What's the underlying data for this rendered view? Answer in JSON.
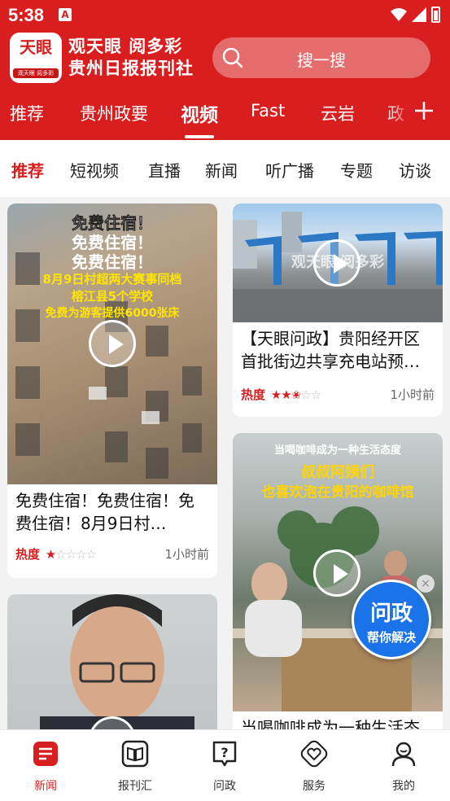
{
  "status_bar": {
    "time": "5:38",
    "notification_badge": "A"
  },
  "header": {
    "logo_text": "天眼",
    "logo_sub": "观天眼 阅多彩",
    "brand_line1": "观天眼 阅多彩",
    "brand_line2": "贵州日报报刊社",
    "search_placeholder": "搜一搜",
    "accent_color": "#d81e1e"
  },
  "channel_tabs": [
    {
      "label": "推荐"
    },
    {
      "label": "贵州政要"
    },
    {
      "label": "视频",
      "active": true
    },
    {
      "label": "Fast"
    },
    {
      "label": "云岩"
    },
    {
      "label": "政"
    }
  ],
  "sub_tabs": [
    {
      "label": "推荐",
      "active": true
    },
    {
      "label": "短视频"
    },
    {
      "label": "直播"
    },
    {
      "label": "新闻"
    },
    {
      "label": "听广播"
    },
    {
      "label": "专题"
    },
    {
      "label": "访谈"
    }
  ],
  "feed": {
    "card1": {
      "overlay": [
        "免费住宿！",
        "免费住宿！",
        "免费住宿！",
        "8月9日村超两大赛事同档",
        "榕江县5个学校",
        "免费为游客提供6000张床"
      ],
      "title": "免费住宿！免费住宿！免费住宿！8月9日村…",
      "heat_label": "热度",
      "heat_stars": 1,
      "time": "1小时前"
    },
    "card2": {
      "overlay": "观天眼 阅多彩",
      "title": "【天眼问政】贵阳经开区首批街边共享充电站预…",
      "heat_label": "热度",
      "heat_stars": 2.5,
      "time": "1小时前"
    },
    "card3": {
      "overlay": [
        "当喝咖啡成为一种生活态度",
        "叔叔阿姨们",
        "也喜欢泡在贵阳的咖啡馆"
      ],
      "title": "当喝咖啡成为一种生活态度"
    },
    "card4": {
      "title": ""
    }
  },
  "float_button": {
    "line1": "问政",
    "line2": "帮你解决",
    "close": "×"
  },
  "bottom_nav": [
    {
      "label": "新闻",
      "icon": "news-icon",
      "active": true
    },
    {
      "label": "报刊汇",
      "icon": "book-icon"
    },
    {
      "label": "问政",
      "icon": "question-icon"
    },
    {
      "label": "服务",
      "icon": "heart-service-icon"
    },
    {
      "label": "我的",
      "icon": "user-icon"
    }
  ]
}
